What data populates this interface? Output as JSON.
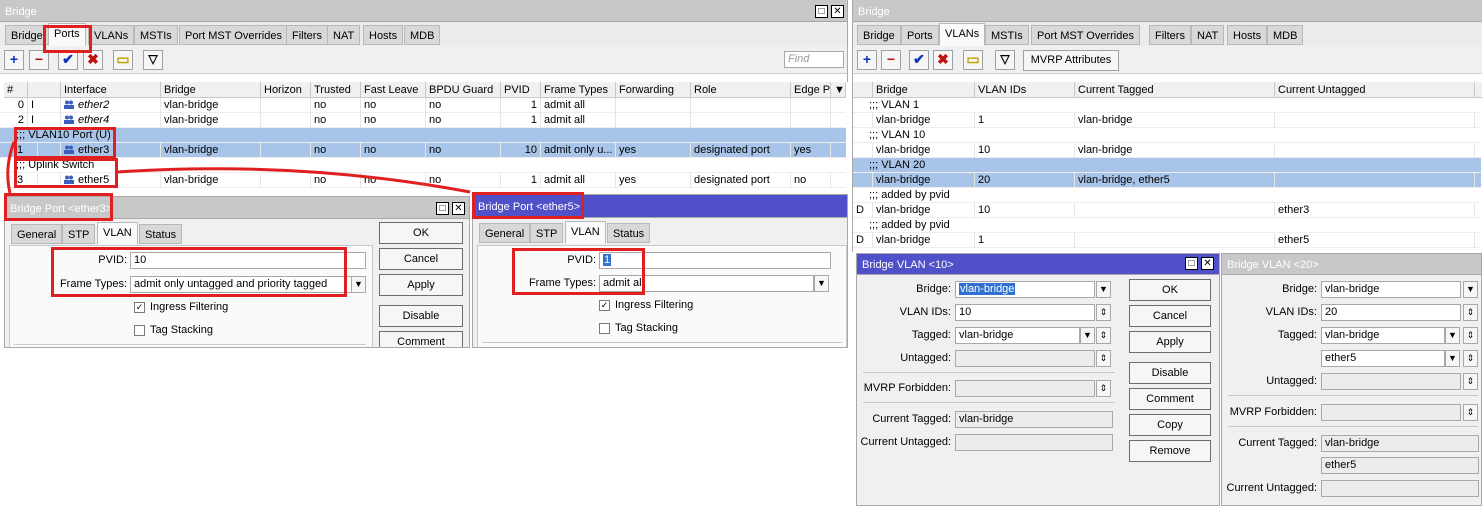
{
  "left": {
    "title": "Bridge",
    "tabs": [
      "Bridge",
      "Ports",
      "VLANs",
      "MSTIs",
      "Port MST Overrides",
      "Filters",
      "NAT",
      "Hosts",
      "MDB"
    ],
    "selected_tab": "Ports",
    "find_placeholder": "Find",
    "columns": [
      "#",
      "Interface",
      "Bridge",
      "Horizon",
      "Trusted",
      "Fast Leave",
      "BPDU Guard",
      "PVID",
      "Frame Types",
      "Forwarding",
      "Role",
      "Edge P"
    ],
    "rows": [
      {
        "kind": "row",
        "num": "0",
        "flag": "I",
        "iface": "ether2",
        "bridge": "vlan-bridge",
        "horizon": "",
        "trusted": "no",
        "fastleave": "no",
        "bpdu": "no",
        "pvid": "1",
        "frame": "admit all",
        "fwd": "",
        "role": "",
        "edge": ""
      },
      {
        "kind": "row",
        "num": "2",
        "flag": "I",
        "iface": "ether4",
        "bridge": "vlan-bridge",
        "horizon": "",
        "trusted": "no",
        "fastleave": "no",
        "bpdu": "no",
        "pvid": "1",
        "frame": "admit all",
        "fwd": "",
        "role": "",
        "edge": ""
      },
      {
        "kind": "comment",
        "text": ";;; VLAN10 Port (U)"
      },
      {
        "kind": "row",
        "num": "1",
        "flag": "",
        "iface": "ether3",
        "bridge": "vlan-bridge",
        "horizon": "",
        "trusted": "no",
        "fastleave": "no",
        "bpdu": "no",
        "pvid": "10",
        "frame": "admit only u...",
        "fwd": "yes",
        "role": "designated port",
        "edge": "yes"
      },
      {
        "kind": "comment",
        "text": ";;; Uplink Switch"
      },
      {
        "kind": "row",
        "num": "3",
        "flag": "",
        "iface": "ether5",
        "bridge": "vlan-bridge",
        "horizon": "",
        "trusted": "no",
        "fastleave": "no",
        "bpdu": "no",
        "pvid": "1",
        "frame": "admit all",
        "fwd": "yes",
        "role": "designated port",
        "edge": "no"
      }
    ]
  },
  "bp3": {
    "title": "Bridge Port <ether3>",
    "tabs": [
      "General",
      "STP",
      "VLAN",
      "Status"
    ],
    "selected_tab": "VLAN",
    "pvid_label": "PVID:",
    "pvid": "10",
    "frame_label": "Frame Types:",
    "frame": "admit only untagged and priority tagged",
    "ingress": "Ingress Filtering",
    "tagstack": "Tag Stacking",
    "buttons": [
      "OK",
      "Cancel",
      "Apply",
      "Disable",
      "Comment"
    ]
  },
  "bp5": {
    "title": "Bridge Port <ether5>",
    "tabs": [
      "General",
      "STP",
      "VLAN",
      "Status"
    ],
    "selected_tab": "VLAN",
    "pvid_label": "PVID:",
    "pvid": "1",
    "frame_label": "Frame Types:",
    "frame": "admit all",
    "ingress": "Ingress Filtering",
    "tagstack": "Tag Stacking"
  },
  "right": {
    "title": "Bridge",
    "tabs": [
      "Bridge",
      "Ports",
      "VLANs",
      "MSTIs",
      "Port MST Overrides",
      "Filters",
      "NAT",
      "Hosts",
      "MDB"
    ],
    "selected_tab": "VLANs",
    "mvrp_button": "MVRP Attributes",
    "columns": [
      "Bridge",
      "VLAN IDs",
      "Current Tagged",
      "Current Untagged"
    ],
    "rows": [
      {
        "kind": "comment",
        "text": ";;; VLAN 1"
      },
      {
        "kind": "row",
        "flag": "",
        "bridge": "vlan-bridge",
        "ids": "1",
        "tagged": "vlan-bridge",
        "untagged": ""
      },
      {
        "kind": "comment",
        "text": ";;; VLAN 10"
      },
      {
        "kind": "row",
        "flag": "",
        "bridge": "vlan-bridge",
        "ids": "10",
        "tagged": "vlan-bridge",
        "untagged": ""
      },
      {
        "kind": "comment",
        "text": ";;; VLAN 20"
      },
      {
        "kind": "row",
        "flag": "",
        "bridge": "vlan-bridge",
        "ids": "20",
        "tagged": "vlan-bridge, ether5",
        "untagged": ""
      },
      {
        "kind": "comment",
        "text": ";;; added by pvid"
      },
      {
        "kind": "row",
        "flag": "D",
        "bridge": "vlan-bridge",
        "ids": "10",
        "tagged": "",
        "untagged": "ether3"
      },
      {
        "kind": "comment",
        "text": ";;; added by pvid"
      },
      {
        "kind": "row",
        "flag": "D",
        "bridge": "vlan-bridge",
        "ids": "1",
        "tagged": "",
        "untagged": "ether5"
      }
    ]
  },
  "bv10": {
    "title": "Bridge VLAN <10>",
    "bridge_label": "Bridge:",
    "bridge": "vlan-bridge",
    "ids_label": "VLAN IDs:",
    "ids": "10",
    "tagged_label": "Tagged:",
    "tagged": "vlan-bridge",
    "untagged_label": "Untagged:",
    "mvrp_label": "MVRP Forbidden:",
    "cur_tagged_label": "Current Tagged:",
    "cur_tagged": "vlan-bridge",
    "cur_untagged_label": "Current Untagged:",
    "buttons": [
      "OK",
      "Cancel",
      "Apply",
      "Disable",
      "Comment",
      "Copy",
      "Remove"
    ]
  },
  "bv20": {
    "title": "Bridge VLAN <20>",
    "bridge_label": "Bridge:",
    "bridge": "vlan-bridge",
    "ids_label": "VLAN IDs:",
    "ids": "20",
    "tagged_label": "Tagged:",
    "tagged": "vlan-bridge",
    "tagged2": "ether5",
    "untagged_label": "Untagged:",
    "mvrp_label": "MVRP Forbidden:",
    "cur_tagged_label": "Current Tagged:",
    "cur_tagged": "vlan-bridge",
    "cur_tagged2": "ether5",
    "cur_untagged_label": "Current Untagged:"
  },
  "colors": {
    "accent": "#5050c8",
    "highlight": "#a8c4e8",
    "annotation": "#e02020"
  }
}
